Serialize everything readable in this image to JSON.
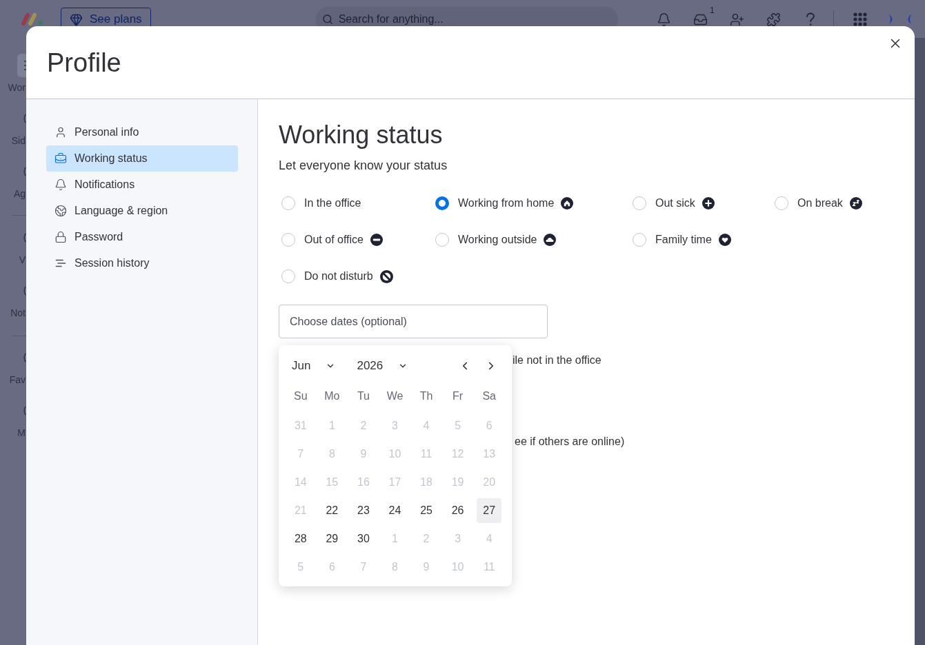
{
  "app": {
    "top_bar": {
      "plans_button": "See plans",
      "search": {
        "placeholder": "Search for anything..."
      },
      "inbox_badge": "1"
    },
    "left_nav": [
      [
        "Wor",
        "Sid",
        "Ag"
      ],
      [
        "V",
        "Not"
      ],
      [
        "Fav",
        "M"
      ]
    ]
  },
  "dialog": {
    "title": "Profile",
    "sidebar": {
      "items": [
        {
          "label": "Personal info",
          "selected": false
        },
        {
          "label": "Working status",
          "selected": true
        },
        {
          "label": "Notifications",
          "selected": false
        },
        {
          "label": "Language & region",
          "selected": false
        },
        {
          "label": "Password",
          "selected": false
        },
        {
          "label": "Session history",
          "selected": false
        }
      ]
    },
    "section": {
      "title": "Working status",
      "subtitle": "Let everyone know your status",
      "statuses": [
        [
          {
            "label": "In the office",
            "selected": false
          },
          {
            "label": "Working from home",
            "selected": true
          },
          {
            "label": "Out sick",
            "selected": false
          },
          {
            "label": "On break",
            "selected": false
          }
        ],
        [
          {
            "label": "Out of office",
            "selected": false
          },
          {
            "label": "Working outside",
            "selected": false
          },
          {
            "label": "Family time",
            "selected": false
          }
        ],
        [
          {
            "label": "Do not disturb",
            "selected": false
          }
        ]
      ],
      "date_field": {
        "placeholder": "Choose dates (optional)"
      },
      "date_picker": {
        "month": "Jun",
        "year": "2026",
        "weekdays": [
          "Su",
          "Mo",
          "Tu",
          "We",
          "Th",
          "Fr",
          "Sa"
        ],
        "weeks": [
          [
            {
              "label": "31",
              "disabled": true,
              "today": false
            },
            {
              "label": "1",
              "disabled": true,
              "today": false
            },
            {
              "label": "2",
              "disabled": true,
              "today": false
            },
            {
              "label": "3",
              "disabled": true,
              "today": false
            },
            {
              "label": "4",
              "disabled": true,
              "today": false
            },
            {
              "label": "5",
              "disabled": true,
              "today": false
            },
            {
              "label": "6",
              "disabled": true,
              "today": false
            }
          ],
          [
            {
              "label": "7",
              "disabled": true,
              "today": false
            },
            {
              "label": "8",
              "disabled": true,
              "today": false
            },
            {
              "label": "9",
              "disabled": true,
              "today": false
            },
            {
              "label": "10",
              "disabled": true,
              "today": false
            },
            {
              "label": "11",
              "disabled": true,
              "today": false
            },
            {
              "label": "12",
              "disabled": true,
              "today": false
            },
            {
              "label": "13",
              "disabled": true,
              "today": false
            }
          ],
          [
            {
              "label": "14",
              "disabled": true,
              "today": false
            },
            {
              "label": "15",
              "disabled": true,
              "today": false
            },
            {
              "label": "16",
              "disabled": true,
              "today": false
            },
            {
              "label": "17",
              "disabled": true,
              "today": false
            },
            {
              "label": "18",
              "disabled": true,
              "today": false
            },
            {
              "label": "19",
              "disabled": true,
              "today": false
            },
            {
              "label": "20",
              "disabled": true,
              "today": false
            }
          ],
          [
            {
              "label": "21",
              "disabled": true,
              "today": false
            },
            {
              "label": "22",
              "disabled": false,
              "today": false
            },
            {
              "label": "23",
              "disabled": false,
              "today": false
            },
            {
              "label": "24",
              "disabled": false,
              "today": false
            },
            {
              "label": "25",
              "disabled": false,
              "today": false
            },
            {
              "label": "26",
              "disabled": false,
              "today": false
            },
            {
              "label": "27",
              "disabled": false,
              "today": true
            }
          ],
          [
            {
              "label": "28",
              "disabled": false,
              "today": false
            },
            {
              "label": "29",
              "disabled": false,
              "today": false
            },
            {
              "label": "30",
              "disabled": false,
              "today": false
            },
            {
              "label": "1",
              "disabled": true,
              "today": false
            },
            {
              "label": "2",
              "disabled": true,
              "today": false
            },
            {
              "label": "3",
              "disabled": true,
              "today": false
            },
            {
              "label": "4",
              "disabled": true,
              "today": false
            }
          ],
          [
            {
              "label": "5",
              "disabled": true,
              "today": false
            },
            {
              "label": "6",
              "disabled": true,
              "today": false
            },
            {
              "label": "7",
              "disabled": true,
              "today": false
            },
            {
              "label": "8",
              "disabled": true,
              "today": false
            },
            {
              "label": "9",
              "disabled": true,
              "today": false
            },
            {
              "label": "10",
              "disabled": true,
              "today": false
            },
            {
              "label": "11",
              "disabled": true,
              "today": false
            }
          ]
        ]
      },
      "options_partial": [
        "ile not in the office",
        "ee if others are online)"
      ]
    }
  }
}
